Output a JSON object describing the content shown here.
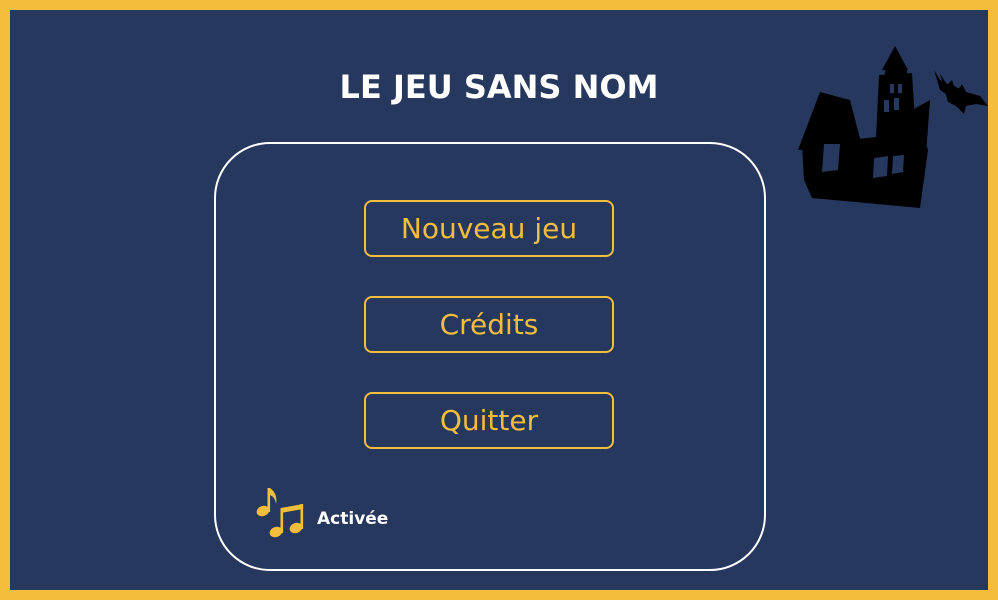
{
  "game": {
    "title": "LE JEU SANS NOM"
  },
  "menu": {
    "buttons": [
      {
        "label": "Nouveau jeu"
      },
      {
        "label": "Crédits"
      },
      {
        "label": "Quitter"
      }
    ]
  },
  "music": {
    "status": "Activée",
    "icon": "music-notes-icon"
  },
  "decoration": {
    "icon": "haunted-house-icon"
  },
  "colors": {
    "background": "#27385f",
    "accent": "#f4bd3c",
    "panel_border": "#ffffff",
    "silhouette": "#000000"
  }
}
